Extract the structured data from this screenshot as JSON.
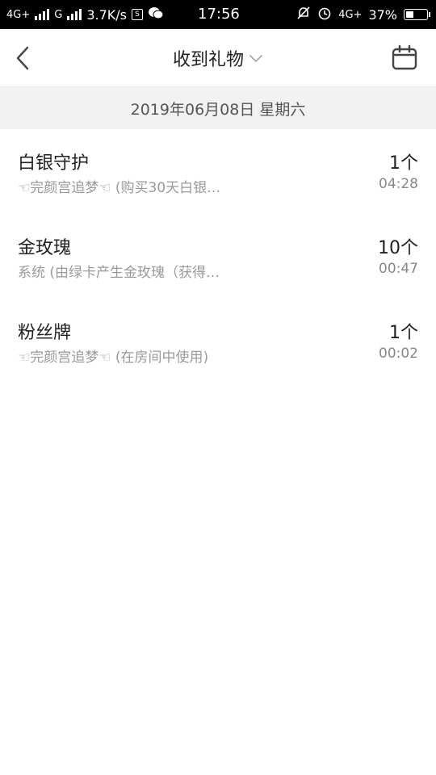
{
  "status_bar": {
    "net1": "4G+",
    "net2": "G",
    "speed": "3.7K/s",
    "s_icon_text": "S",
    "time": "17:56",
    "net3": "4G+",
    "battery": "37%",
    "battery_level": 0.37
  },
  "header": {
    "title": "收到礼物"
  },
  "date_label": "2019年06月08日 星期六",
  "gifts": [
    {
      "name": "白银守护",
      "desc": "☜完颜宫追梦☜ (购买30天白银…",
      "count": "1个",
      "time": "04:28"
    },
    {
      "name": "金玫瑰",
      "desc": "系统 (由绿卡产生金玫瑰（获得…",
      "count": "10个",
      "time": "00:47"
    },
    {
      "name": "粉丝牌",
      "desc": "☜完颜宫追梦☜ (在房间中使用)",
      "count": "1个",
      "time": "00:02"
    }
  ]
}
